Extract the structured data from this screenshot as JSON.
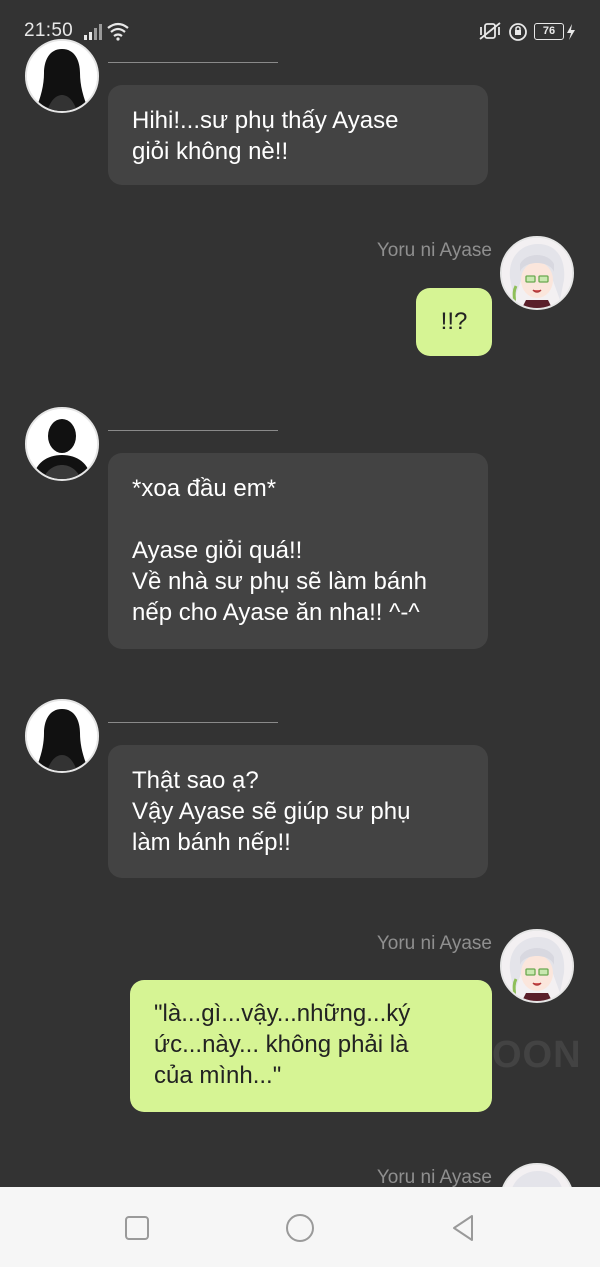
{
  "status_bar": {
    "time": "21:50",
    "battery": "76",
    "icons": [
      "signal-icon",
      "wifi-icon",
      "vibrate-icon",
      "alarm-icon",
      "battery-icon",
      "charging-icon"
    ]
  },
  "messages": [
    {
      "side": "left",
      "sender": "",
      "avatar": "silhouette-long-hair",
      "text": "Hihi!...sư phụ thấy Ayase\ngiỏi không nè!!"
    },
    {
      "side": "right",
      "sender": "Yoru ni Ayase",
      "avatar": "anime-girl",
      "text": "!!?"
    },
    {
      "side": "left",
      "sender": "",
      "avatar": "silhouette-short-hair",
      "text": "*xoa đầu em*\n\nAyase giỏi quá!!\nVề nhà sư phụ sẽ làm bánh\nnếp cho Ayase ăn nha!! ^-^"
    },
    {
      "side": "left",
      "sender": "",
      "avatar": "silhouette-long-hair",
      "text": "Thật sao ạ?\nVậy Ayase sẽ giúp sư phụ\nlàm bánh nếp!!"
    },
    {
      "side": "right",
      "sender": "Yoru ni Ayase",
      "avatar": "anime-girl",
      "text": "\"là...gì...vậy...những...ký\nức...này... không phải là\ncủa mình...\""
    },
    {
      "side": "right",
      "sender": "Yoru ni Ayase",
      "avatar": "anime-girl",
      "text": ""
    }
  ],
  "watermark": "OON",
  "nav_bar": {
    "buttons": [
      "recent-apps-icon",
      "home-icon",
      "back-icon"
    ]
  },
  "colors": {
    "background": "#333333",
    "left_bubble": "#434343",
    "right_bubble": "#d6f494",
    "sender_name": "#8f8f8f",
    "nav_bar": "#f6f6f6"
  }
}
